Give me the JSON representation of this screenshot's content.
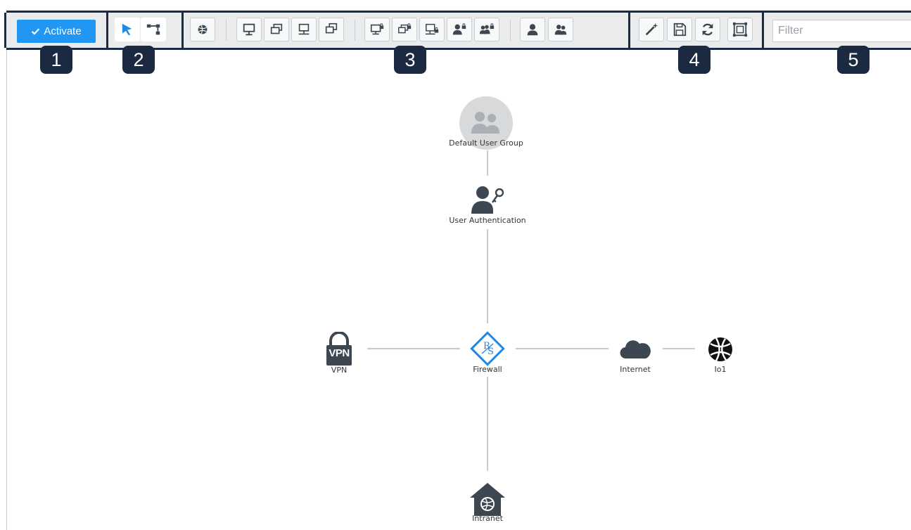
{
  "toolbar": {
    "activate_label": "Activate",
    "filter_placeholder": "Filter",
    "filter_value": "",
    "accent_color": "#2196f3",
    "border_color": "#1c2c40",
    "mode_tools": [
      {
        "name": "select-pointer-icon",
        "selected": true
      },
      {
        "name": "connect-tool-icon",
        "selected": false
      }
    ],
    "object_tools": [
      "internet-object-icon",
      "host-icon",
      "multi-host-icon",
      "network-host-icon",
      "host-group-icon",
      "locked-host-icon",
      "locked-multi-host-icon",
      "locked-network-host-icon",
      "locked-user-icon",
      "locked-user-group-icon",
      "user-icon",
      "user-group-icon"
    ],
    "action_tools": [
      "magic-wand-icon",
      "save-icon",
      "refresh-icon",
      "fit-to-screen-icon"
    ]
  },
  "callouts": [
    "1",
    "2",
    "3",
    "4",
    "5"
  ],
  "diagram": {
    "nodes": {
      "user_group": "Default User Group",
      "user_auth": "User Authentication",
      "firewall": "Firewall",
      "vpn": "VPN",
      "vpn_badge": "VPN",
      "internet": "Internet",
      "io1": "Io1",
      "intranet": "Intranet"
    }
  }
}
